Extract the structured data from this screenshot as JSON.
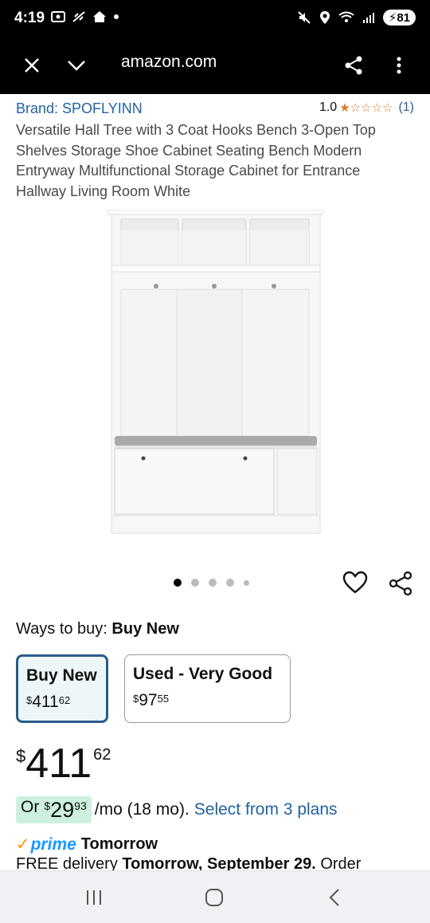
{
  "status_bar": {
    "time": "4:19",
    "battery": "81"
  },
  "browser": {
    "url": "amazon.com"
  },
  "product": {
    "brand": "Brand: SPOFLYINN",
    "rating_value": "1.0",
    "rating_count": "(1)",
    "title": "Versatile Hall Tree with 3 Coat Hooks Bench 3-Open Top Shelves Storage Shoe Cabinet Seating Bench Modern Entryway Multifunctional Storage Cabinet for Entrance Hallway Living Room White",
    "image_count": 5,
    "active_image": 1
  },
  "buying": {
    "ways_label": "Ways to buy:",
    "ways_value": "Buy New",
    "options": [
      {
        "label": "Buy New",
        "currency": "$",
        "whole": "411",
        "fraction": "62",
        "selected": true
      },
      {
        "label": "Used - Very Good",
        "currency": "$",
        "whole": "97",
        "fraction": "55",
        "selected": false
      }
    ],
    "price": {
      "currency": "$",
      "whole": "411",
      "fraction": "62"
    },
    "finance": {
      "prefix": "Or",
      "currency": "$",
      "whole": "29",
      "fraction": "93",
      "term": "/mo (18 mo).",
      "link": "Select from 3 plans"
    }
  },
  "delivery": {
    "prime_label": "prime",
    "speed": "Tomorrow",
    "line_prefix": "FREE delivery",
    "line_date": "Tomorrow, September 29.",
    "line_suffix": "Order"
  },
  "colors": {
    "link": "#2162a1",
    "star": "#de7921",
    "selected_border": "#2a5c8a",
    "finance_bg": "#cdf0df",
    "prime": "#1a98ff"
  }
}
